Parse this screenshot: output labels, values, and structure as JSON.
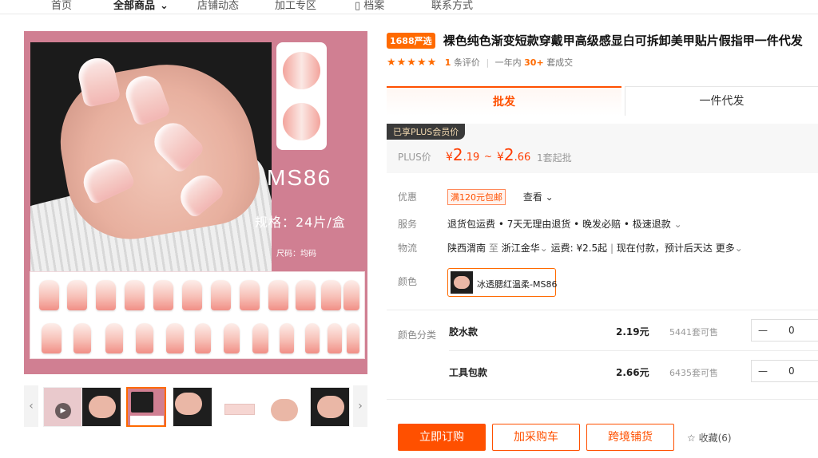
{
  "nav": {
    "items": [
      "首页",
      "全部商品",
      "店铺动态",
      "加工专区",
      "档案",
      "联系方式"
    ]
  },
  "gallery": {
    "model": "MS86",
    "spec": "规格：24片/盒",
    "size_label": "尺码：均码",
    "prev_icon": "chevron-left-icon",
    "next_icon": "chevron-right-icon"
  },
  "product": {
    "badge": "1688严选",
    "title": "裸色纯色渐变短款穿戴甲高级感显白可拆卸美甲贴片假指甲一件代发",
    "stars": "★★★★★",
    "review_count": "1",
    "review_suffix": "条评价",
    "sales_prefix": "一年内",
    "sales_count": "30+",
    "sales_suffix": "套成交"
  },
  "tabs": {
    "wholesale": "批发",
    "dropship": "一件代发"
  },
  "price": {
    "plus_tag": "已享PLUS会员价",
    "plus_label": "PLUS价",
    "currency": "¥",
    "low_int": "2",
    "low_dec": ".19",
    "tilde": "~",
    "high_int": "2",
    "high_dec": ".66",
    "moq": "1套起批"
  },
  "details": {
    "promo_label": "优惠",
    "coupon": "满120元包邮",
    "view": "查看",
    "service_label": "服务",
    "service": "退货包运费 • 7天无理由退货 • 晚发必赔 • 极速退款",
    "logistics_label": "物流",
    "origin": "陕西渭南",
    "to": "至",
    "destination": "浙江金华",
    "freight": "运费: ¥2.5起",
    "shipping_note": "现在付款，预计后天达",
    "more": "更多",
    "color_label": "颜色",
    "color_option": "冰透腮红温柔-MS86"
  },
  "sku": {
    "label": "颜色分类",
    "rows": [
      {
        "name": "胶水款",
        "price": "2.19元",
        "stock": "5441套可售",
        "qty": "0"
      },
      {
        "name": "工具包款",
        "price": "2.66元",
        "stock": "6435套可售",
        "qty": "0"
      }
    ],
    "minus": "—"
  },
  "actions": {
    "buy": "立即订购",
    "cart": "加采购车",
    "cross_border": "跨境铺货",
    "favorite": "☆ 收藏(6)"
  }
}
